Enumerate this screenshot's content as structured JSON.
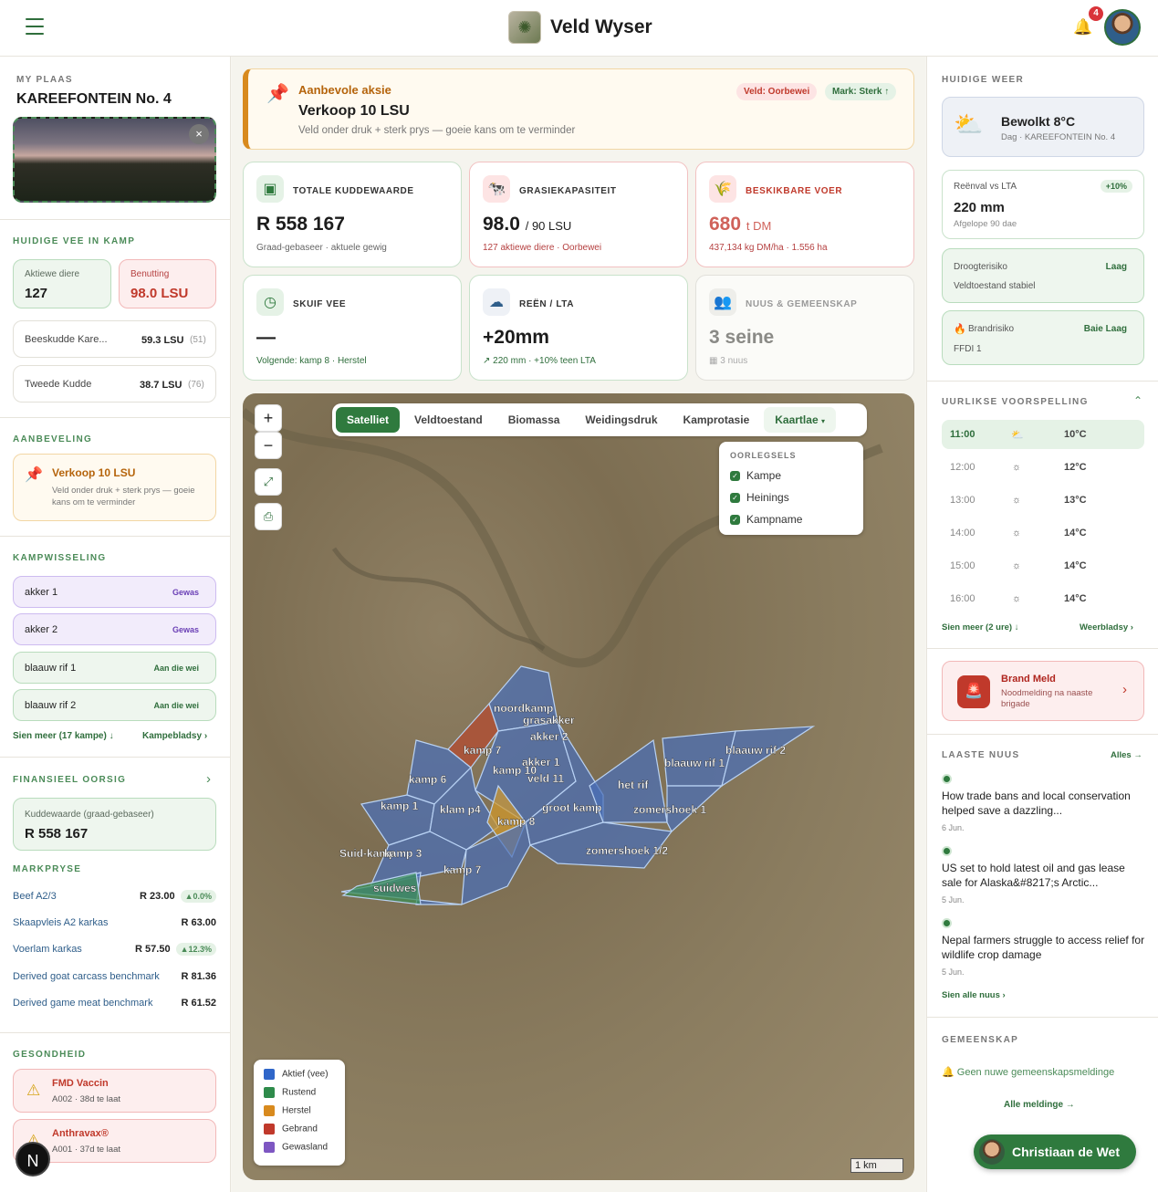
{
  "app": {
    "title": "Veld Wyser",
    "notifications": "4"
  },
  "farm": {
    "section": "MY PLAAS",
    "name": "KAREEFONTEIN No. 4",
    "close": "×"
  },
  "livestock": {
    "section": "HUIDIGE VEE IN KAMP",
    "active_label": "Aktiewe diere",
    "active_value": "127",
    "usage_label": "Benutting",
    "usage_value": "98.0 LSU",
    "herds": [
      {
        "name": "Beeskudde Kare...",
        "lsu": "59.3 LSU",
        "count": "(51)"
      },
      {
        "name": "Tweede Kudde",
        "lsu": "38.7 LSU",
        "count": "(76)"
      }
    ]
  },
  "recommendation": {
    "section": "AANBEVELING",
    "title": "Verkoop 10 LSU",
    "text": "Veld onder druk + sterk prys — goeie kans om te verminder"
  },
  "rotation": {
    "section": "KAMPWISSELING",
    "items": [
      {
        "name": "akker 1",
        "status": "Gewas"
      },
      {
        "name": "akker 2",
        "status": "Gewas"
      },
      {
        "name": "blaauw rif 1",
        "status": "Aan die wei"
      },
      {
        "name": "blaauw rif 2",
        "status": "Aan die wei"
      }
    ],
    "more": "Sien meer (17 kampe) ↓",
    "link": "Kampebladsy"
  },
  "finance": {
    "section": "FINANSIEEL OORSIG",
    "label": "Kuddewaarde (graad-gebaseer)",
    "value": "R 558 167"
  },
  "markets": {
    "section": "MARKPRYSE",
    "rows": [
      {
        "name": "Beef A2/3",
        "price": "R 23.00",
        "change": "▲0.0%"
      },
      {
        "name": "Skaapvleis A2 karkas",
        "price": "R 63.00",
        "change": ""
      },
      {
        "name": "Voerlam karkas",
        "price": "R 57.50",
        "change": "▲12.3%"
      },
      {
        "name": "Derived goat carcass benchmark",
        "price": "R 81.36",
        "change": ""
      },
      {
        "name": "Derived game meat benchmark",
        "price": "R 61.52",
        "change": ""
      }
    ]
  },
  "health": {
    "section": "GESONDHEID",
    "items": [
      {
        "title": "FMD Vaccin",
        "sub": "A002 · 38d te laat"
      },
      {
        "title": "Anthravax®",
        "sub": "A001 · 37d te laat"
      }
    ]
  },
  "alert": {
    "kicker": "Aanbevole aksie",
    "title": "Verkoop 10 LSU",
    "text": "Veld onder druk + sterk prys — goeie kans om te verminder",
    "tag1": "Veld: Oorbewei",
    "tag2": "Mark: Sterk ↑"
  },
  "kpis": [
    {
      "title": "TOTALE KUDDEWAARDE",
      "value": "R 558 167",
      "unit": "",
      "sub": "Graad-gebaseer · aktuele gewig"
    },
    {
      "title": "GRASIEKAPASITEIT",
      "value": "98.0",
      "unit": "/ 90 LSU",
      "sub": "127 aktiewe diere · Oorbewei"
    },
    {
      "title": "BESKIKBARE VOER",
      "value": "680",
      "unit": "t DM",
      "sub": "437,134 kg DM/ha · 1.556 ha"
    },
    {
      "title": "SKUIF VEE",
      "value": "—",
      "unit": "",
      "sub": "Volgende: kamp 8 · Herstel"
    },
    {
      "title": "REËN / LTA",
      "value": "+20mm",
      "unit": "",
      "sub": "220 mm · +10% teen LTA"
    },
    {
      "title": "NUUS & GEMEENSKAP",
      "value": "3 seine",
      "unit": "",
      "sub": "3 nuus"
    }
  ],
  "map": {
    "tabs": [
      "Satelliet",
      "Veldtoestand",
      "Biomassa",
      "Weidingsdruk",
      "Kamprotasie"
    ],
    "layers": "Kaartlae",
    "overlay_title": "OORLEGSELS",
    "overlays": [
      "Kampe",
      "Heinings",
      "Kampname"
    ],
    "legend": [
      {
        "label": "Aktief (vee)",
        "color": "#2f66c9"
      },
      {
        "label": "Rustend",
        "color": "#2e8b4b"
      },
      {
        "label": "Herstel",
        "color": "#d88a1e"
      },
      {
        "label": "Gebrand",
        "color": "#c0392b"
      },
      {
        "label": "Gewasland",
        "color": "#7e57c2"
      }
    ],
    "scale": "1 km",
    "camps": [
      "noordkamp",
      "grasakker",
      "akker 2",
      "kamp 7",
      "akker 1",
      "kamp 10",
      "veld 11",
      "kamp 6",
      "kamp 1",
      "klam p4",
      "kamp 8",
      "groot kamp",
      "het rif",
      "blaauw rif 1",
      "blaauw rif 2",
      "zomershoek 1",
      "zomershoek 1/2",
      "Suid-kamp",
      "kamp 3",
      "kamp 7",
      "suidwes"
    ]
  },
  "weather": {
    "section": "HUIDIGE WEER",
    "cond": "Bewolkt",
    "temp": "8°C",
    "sub": "Dag · KAREEFONTEIN No. 4",
    "rain_label": "Reënval vs LTA",
    "rain_badge": "+10%",
    "rain_value": "220 mm",
    "rain_sub": "Afgelope 90 dae",
    "drought_label": "Droogterisiko",
    "drought_badge": "Laag",
    "drought_sub": "Veldtoestand stabiel",
    "fire_label": "Brandrisiko",
    "fire_badge": "Baie Laag",
    "fire_sub": "FFDI 1"
  },
  "hourly": {
    "section": "UURLIKSE VOORSPELLING",
    "rows": [
      {
        "t": "11:00",
        "temp": "10°C"
      },
      {
        "t": "12:00",
        "temp": "12°C"
      },
      {
        "t": "13:00",
        "temp": "13°C"
      },
      {
        "t": "14:00",
        "temp": "14°C"
      },
      {
        "t": "15:00",
        "temp": "14°C"
      },
      {
        "t": "16:00",
        "temp": "14°C"
      }
    ],
    "more": "Sien meer (2 ure) ↓",
    "link": "Weerbladsy"
  },
  "fire_alert": {
    "title": "Brand Meld",
    "sub": "Noodmelding na naaste brigade"
  },
  "news": {
    "section": "LAASTE NUUS",
    "all": "Alles →",
    "items": [
      {
        "title": "How trade bans and local conservation helped save a dazzling...",
        "date": "6 Jun."
      },
      {
        "title": "US set to hold latest oil and gas lease sale for Alaska&#8217;s Arctic...",
        "date": "5 Jun."
      },
      {
        "title": "Nepal farmers struggle to access relief for wildlife crop damage",
        "date": "5 Jun."
      }
    ],
    "more": "Sien alle nuus"
  },
  "community": {
    "section": "GEMEENSKAP",
    "empty": "Geen nuwe gemeenskapsmeldinge",
    "link": "Alle meldinge →"
  },
  "user": {
    "name": "Christiaan de Wet"
  }
}
